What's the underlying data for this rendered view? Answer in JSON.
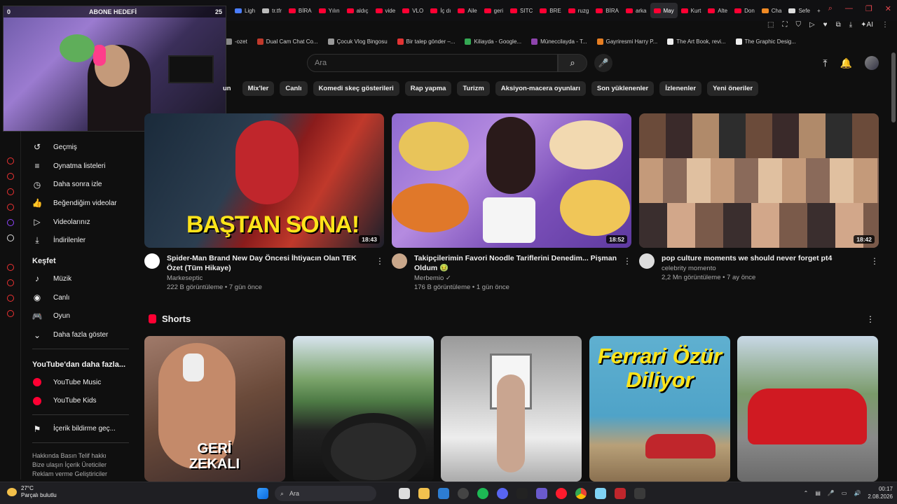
{
  "webcam": {
    "left_count": "0",
    "title": "ABONE HEDEFİ",
    "right_count": "25"
  },
  "browser": {
    "tabs": [
      {
        "label": "Ligh",
        "color": "#4a7dff"
      },
      {
        "label": "tr.tfr",
        "color": "#bbbbbb"
      },
      {
        "label": "BİRA",
        "color": "#ff0033"
      },
      {
        "label": "Yılın",
        "color": "#ff0033"
      },
      {
        "label": "aldıç",
        "color": "#ff0033"
      },
      {
        "label": "vide",
        "color": "#ff0033"
      },
      {
        "label": "VLO",
        "color": "#ff0033"
      },
      {
        "label": "İç dı",
        "color": "#ff0033"
      },
      {
        "label": "Aile",
        "color": "#ff0033"
      },
      {
        "label": "geri",
        "color": "#ff0033"
      },
      {
        "label": "SITC",
        "color": "#ff0033"
      },
      {
        "label": "BRE",
        "color": "#ff0033"
      },
      {
        "label": "ruzg",
        "color": "#ff0033"
      },
      {
        "label": "BİRA",
        "color": "#ff0033"
      },
      {
        "label": "arka",
        "color": "#ff0033"
      },
      {
        "label": "May",
        "color": "#ff0033",
        "active": true
      },
      {
        "label": "Kurt",
        "color": "#ff0033"
      },
      {
        "label": "Alte",
        "color": "#ff0033"
      },
      {
        "label": "Don",
        "color": "#ff0033"
      },
      {
        "label": "Cha",
        "color": "#f08a24"
      },
      {
        "label": "Sefe",
        "color": "#dddddd"
      }
    ],
    "new_tab": "+",
    "bookmarks": [
      {
        "label": "-ozet",
        "color": "#888888"
      },
      {
        "label": "Dual Cam Chat Co...",
        "color": "#c0392b"
      },
      {
        "label": "Çocuk Vlog Bingosu",
        "color": "#999999"
      },
      {
        "label": "Bir talep gönder –...",
        "color": "#e33333"
      },
      {
        "label": "Kiliayda - Google...",
        "color": "#34a853"
      },
      {
        "label": "Müneccilayda - T...",
        "color": "#8e44ad"
      },
      {
        "label": "Gayriresmi Harry P...",
        "color": "#e67e22"
      },
      {
        "label": "The Art Book, revi...",
        "color": "#eeeeee"
      },
      {
        "label": "The Graphic Desig...",
        "color": "#eeeeee"
      }
    ]
  },
  "search": {
    "placeholder": "Ara"
  },
  "chips": [
    "un",
    "Mix'ler",
    "Canlı",
    "Komedi skeç gösterileri",
    "Rap yapma",
    "Turizm",
    "Aksiyon-macera oyunları",
    "Son yüklenenler",
    "İzlenenler",
    "Yeni öneriler"
  ],
  "sidebar": {
    "items": [
      {
        "label": "Geçmiş",
        "icon": "history-icon",
        "glyph": "↺"
      },
      {
        "label": "Oynatma listeleri",
        "icon": "playlist-icon",
        "glyph": "≡"
      },
      {
        "label": "Daha sonra izle",
        "icon": "clock-icon",
        "glyph": "◷"
      },
      {
        "label": "Beğendiğim videolar",
        "icon": "thumbs-up-icon",
        "glyph": "👍"
      },
      {
        "label": "Videolarınız",
        "icon": "video-icon",
        "glyph": "▷"
      },
      {
        "label": "İndirilenler",
        "icon": "download-icon",
        "glyph": "⤓"
      }
    ],
    "explore_title": "Keşfet",
    "explore": [
      {
        "label": "Müzik",
        "icon": "music-icon",
        "glyph": "♪"
      },
      {
        "label": "Canlı",
        "icon": "live-icon",
        "glyph": "◉"
      },
      {
        "label": "Oyun",
        "icon": "gaming-icon",
        "glyph": "🎮"
      },
      {
        "label": "Daha fazla göster",
        "icon": "chevron-down-icon",
        "glyph": "⌄"
      }
    ],
    "more_title": "YouTube'dan daha fazla...",
    "more": [
      {
        "label": "YouTube Music",
        "icon": "youtube-music-icon"
      },
      {
        "label": "YouTube Kids",
        "icon": "youtube-kids-icon"
      }
    ],
    "report": "İçerik bildirme geç...",
    "footer1": "Hakkında  Basın  Telif hakkı",
    "footer2": "Bize ulaşın  İçerik Üreticiler",
    "footer3": "Reklam verme  Geliştiriciler"
  },
  "videos": [
    {
      "title": "Spider-Man Brand New Day Öncesi İhtiyacın Olan TEK Özet (Tüm Hikaye)",
      "channel": "Markeseptic",
      "stats": "222 B görüntüleme • 7 gün önce",
      "duration": "18:43",
      "overlay": "BAŞTAN SONA!"
    },
    {
      "title": "Takipçilerimin Favori Noodle Tariflerini Denedim... Pişman Oldum 🤢",
      "channel": "Merbemio ✓",
      "stats": "176 B görüntüleme • 1 gün önce",
      "duration": "18:52"
    },
    {
      "title": "pop culture moments we should never forget pt4",
      "channel": "celebrity momento",
      "stats": "2,2 Mn görüntüleme • 7 ay önce",
      "duration": "18:42"
    }
  ],
  "shorts": {
    "title": "Shorts",
    "items": [
      {
        "caption": "GERİ ZEKALI"
      },
      {
        "caption": ""
      },
      {
        "caption": ""
      },
      {
        "caption": "Ferrari Özür Diliyor"
      },
      {
        "caption": ""
      }
    ]
  },
  "taskbar": {
    "temp": "27°C",
    "weather": "Parçalı bulutlu",
    "search": "Ara",
    "time": "00:17",
    "date": "2.08.2026"
  }
}
